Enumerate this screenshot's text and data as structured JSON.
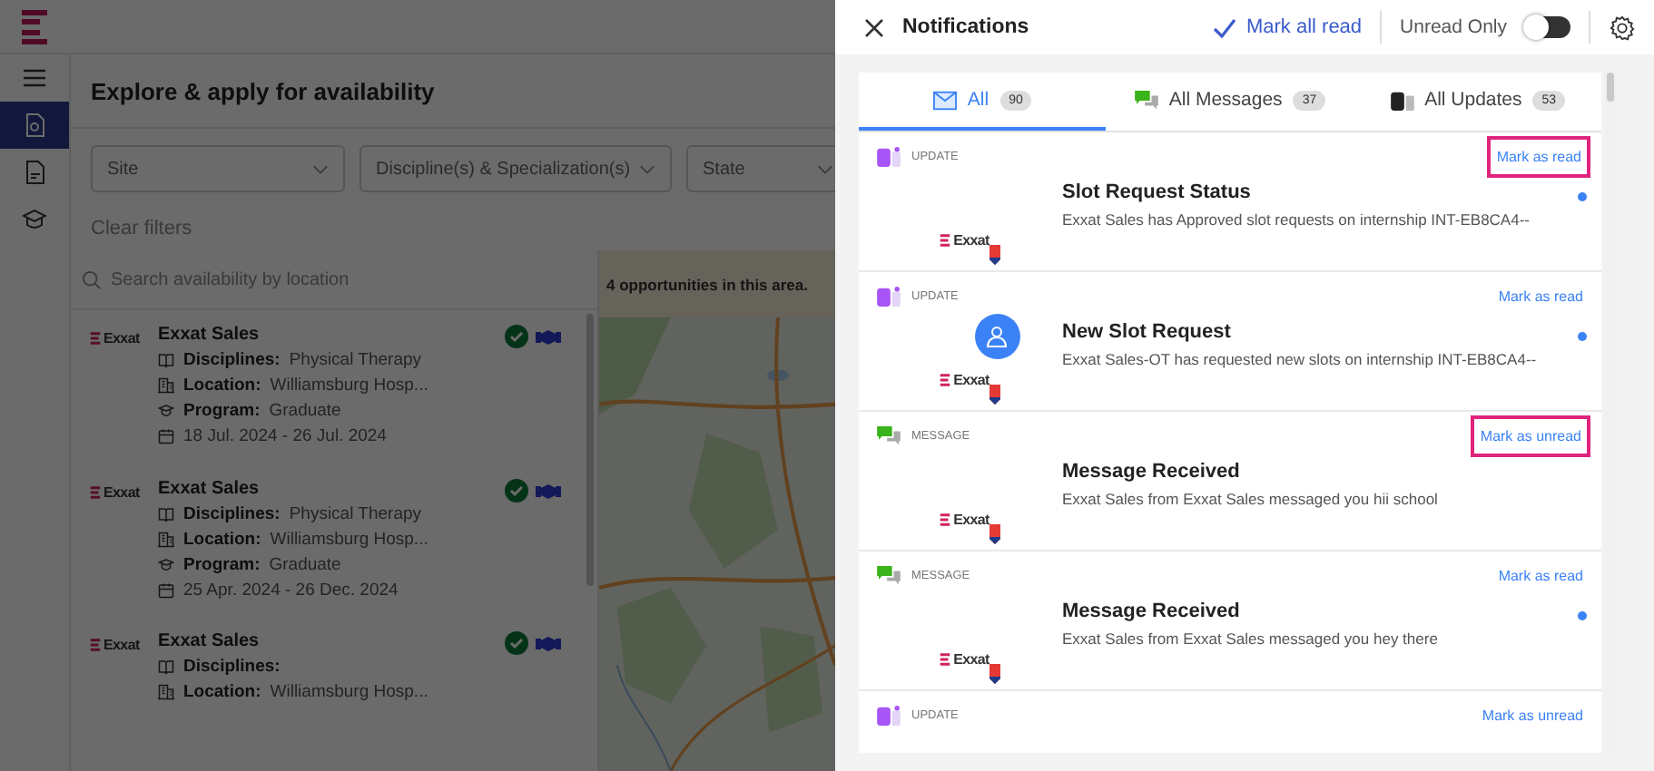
{
  "app": {
    "page_title": "Explore & apply for availability",
    "filters": [
      {
        "placeholder": "Site"
      },
      {
        "placeholder": "Discipline(s) & Specialization(s)"
      },
      {
        "placeholder": "State"
      }
    ],
    "clear_filters": "Clear filters",
    "search": {
      "placeholder": "Search availability by location"
    },
    "listings": [
      {
        "logo_text": "Exxat",
        "name": "Exxat Sales",
        "fields": [
          {
            "kind": "discipline",
            "label": "Disciplines:",
            "value": "Physical Therapy"
          },
          {
            "kind": "location",
            "label": "Location:",
            "value": "Williamsburg Hosp..."
          },
          {
            "kind": "program",
            "label": "Program:",
            "value": "Graduate"
          },
          {
            "kind": "date",
            "value": "18 Jul. 2024 - 26 Jul. 2024"
          }
        ]
      },
      {
        "logo_text": "Exxat",
        "name": "Exxat Sales",
        "fields": [
          {
            "kind": "discipline",
            "label": "Disciplines:",
            "value": "Physical Therapy"
          },
          {
            "kind": "location",
            "label": "Location:",
            "value": "Williamsburg Hosp..."
          },
          {
            "kind": "program",
            "label": "Program:",
            "value": "Graduate"
          },
          {
            "kind": "date",
            "value": "25 Apr. 2024 - 26 Dec. 2024"
          }
        ]
      },
      {
        "logo_text": "Exxat",
        "name": "Exxat Sales",
        "fields": [
          {
            "kind": "discipline",
            "label": "Disciplines:"
          },
          {
            "kind": "location",
            "label": "Location:",
            "value": "Williamsburg Hosp..."
          }
        ]
      }
    ],
    "map": {
      "banner": "4 opportunities in this area.",
      "kind": "picture"
    }
  },
  "notifications": {
    "title": "Notifications",
    "mark_all_read": "Mark all read",
    "unread_only": {
      "label": "Unread Only",
      "on": false
    },
    "tabs": [
      {
        "kind": "all",
        "label": "All",
        "count": "90",
        "selected": true
      },
      {
        "kind": "messages",
        "label": "All Messages",
        "count": "37",
        "selected": false
      },
      {
        "kind": "updates",
        "label": "All Updates",
        "count": "53",
        "selected": false
      }
    ],
    "items": [
      {
        "kind": "update",
        "type_label": "UPDATE",
        "action": "Mark as read",
        "highlighted": true,
        "title": "Slot Request Status",
        "body": "Exxat Sales has Approved slot requests on internship INT-EB8CA4--",
        "logo_text": "Exxat",
        "unread": true,
        "avatar": false
      },
      {
        "kind": "update",
        "type_label": "UPDATE",
        "action": "Mark as read",
        "highlighted": false,
        "title": "New Slot Request",
        "body": "Exxat Sales-OT has requested new slots on internship INT-EB8CA4--",
        "logo_text": "Exxat",
        "unread": true,
        "avatar": true
      },
      {
        "kind": "message",
        "type_label": "MESSAGE",
        "action": "Mark as unread",
        "highlighted": true,
        "title": "Message Received",
        "body": "Exxat Sales from Exxat Sales messaged you hii school",
        "logo_text": "Exxat",
        "unread": false,
        "avatar": false
      },
      {
        "kind": "message",
        "type_label": "MESSAGE",
        "action": "Mark as read",
        "highlighted": false,
        "title": "Message Received",
        "body": "Exxat Sales from Exxat Sales messaged you hey there",
        "logo_text": "Exxat",
        "unread": true,
        "avatar": false
      },
      {
        "kind": "update",
        "type_label": "UPDATE",
        "action": "Mark as unread",
        "highlighted": false
      }
    ]
  }
}
